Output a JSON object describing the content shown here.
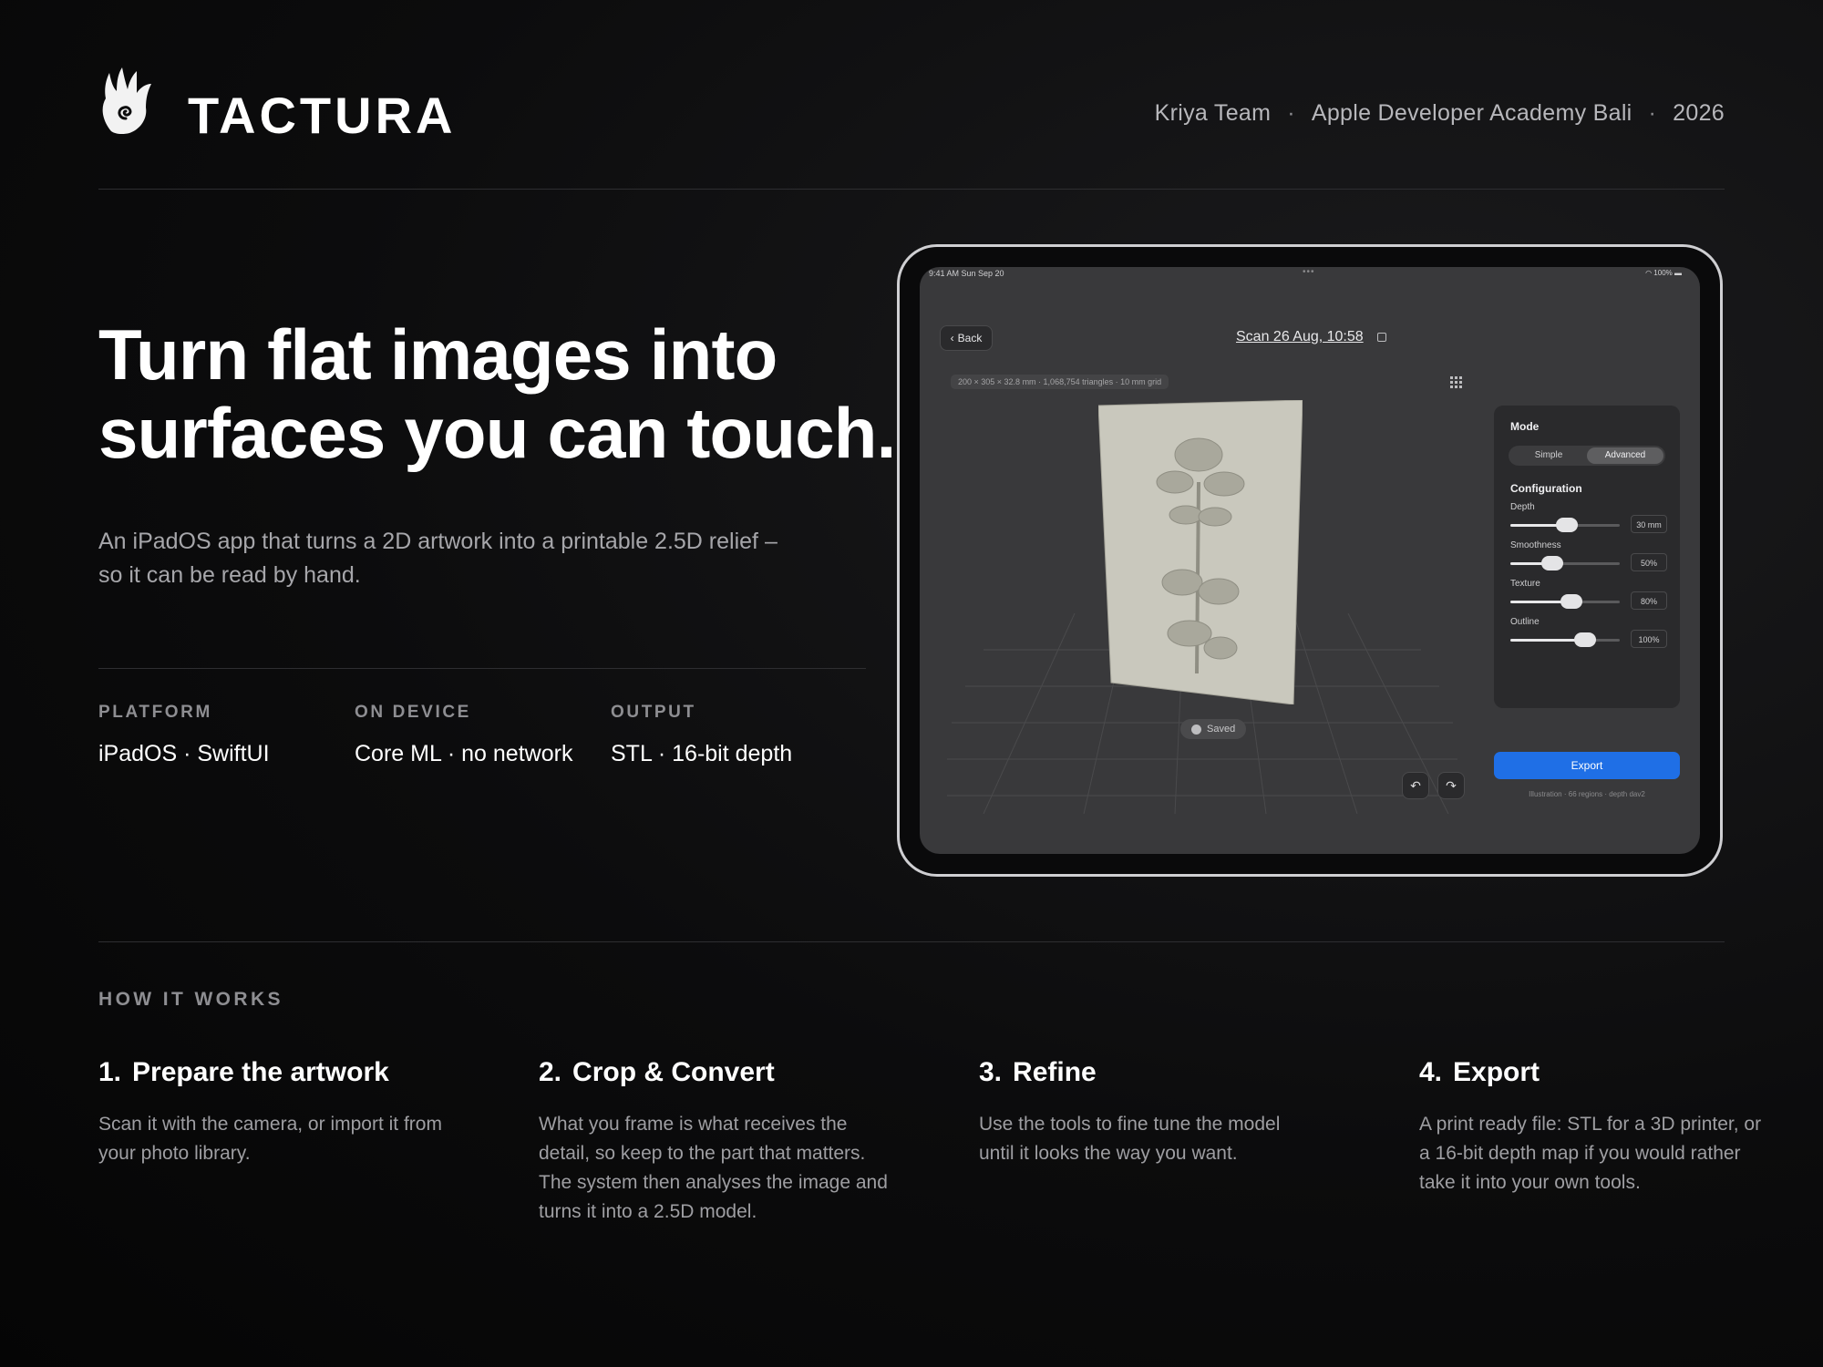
{
  "header": {
    "brand": "TACTURA",
    "team": "Kriya Team",
    "academy": "Apple Developer Academy Bali",
    "year": "2026",
    "separator": "·"
  },
  "hero": {
    "title_line1": "Turn flat images into",
    "title_line2": "surfaces you can touch.",
    "subtitle_line1": "An iPadOS app that turns a 2D artwork into a printable 2.5D relief –",
    "subtitle_line2": "so it can be read by hand."
  },
  "specs": [
    {
      "label": "PLATFORM",
      "value": "iPadOS · SwiftUI"
    },
    {
      "label": "ON DEVICE",
      "value": "Core ML · no network"
    },
    {
      "label": "OUTPUT",
      "value": "STL · 16-bit depth"
    }
  ],
  "app": {
    "status_time": "9:41 AM   Sun Sep 20",
    "status_battery": "100%",
    "back_label": "Back",
    "scan_title": "Scan 26 Aug, 10:58",
    "dimensions": "200 × 305 × 32.8 mm · 1,068,754 triangles · 10 mm grid",
    "saved_label": "Saved",
    "panel": {
      "mode_label": "Mode",
      "mode_options": [
        "Simple",
        "Advanced"
      ],
      "selected_mode": "Advanced",
      "config_label": "Configuration",
      "sliders": [
        {
          "label": "Depth",
          "value": "30 mm",
          "fraction": 0.52
        },
        {
          "label": "Smoothness",
          "value": "50%",
          "fraction": 0.38
        },
        {
          "label": "Texture",
          "value": "80%",
          "fraction": 0.56
        },
        {
          "label": "Outline",
          "value": "100%",
          "fraction": 0.68
        }
      ]
    },
    "export_label": "Export",
    "export_note": "Illustration · 66 regions · depth dav2"
  },
  "how_it_works": {
    "heading": "HOW IT WORKS",
    "steps": [
      {
        "number": "1.",
        "title": "Prepare the artwork",
        "desc": [
          "Scan it with the camera, or import it from",
          "your photo library."
        ]
      },
      {
        "number": "2.",
        "title": "Crop & Convert",
        "desc": [
          "What you frame is what receives the",
          "detail, so keep to the part that matters.",
          "The system then analyses the image and",
          "turns it into a 2.5D model."
        ]
      },
      {
        "number": "3.",
        "title": "Refine",
        "desc": [
          "Use the tools to fine tune the model",
          "until it looks the way you want."
        ]
      },
      {
        "number": "4.",
        "title": "Export",
        "desc": [
          "A print ready file: STL for a 3D printer, or",
          "a 16-bit depth map if you would rather",
          "take it into your own tools."
        ]
      }
    ]
  }
}
